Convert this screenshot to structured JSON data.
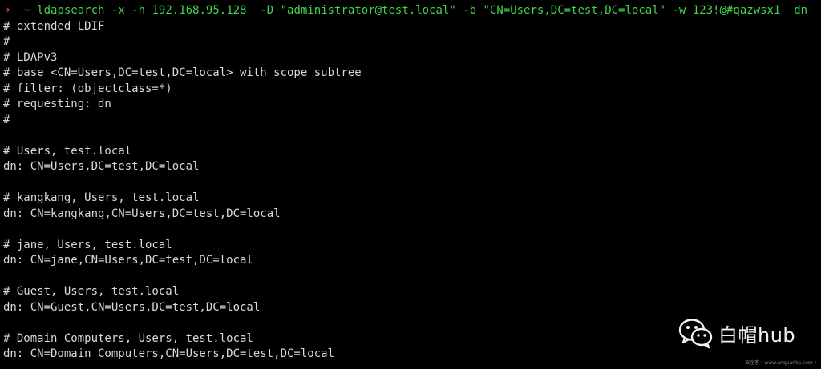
{
  "terminal": {
    "prompt": {
      "arrow": "➜",
      "cwd": "~",
      "command": "ldapsearch",
      "args": "-x -h 192.168.95.128  -D \"administrator@test.local\" -b \"CN=Users,DC=test,DC=local\" -w 123!@#qazwsx1  dn"
    },
    "output_lines": [
      "# extended LDIF",
      "#",
      "# LDAPv3",
      "# base <CN=Users,DC=test,DC=local> with scope subtree",
      "# filter: (objectclass=*)",
      "# requesting: dn",
      "#",
      "",
      "# Users, test.local",
      "dn: CN=Users,DC=test,DC=local",
      "",
      "# kangkang, Users, test.local",
      "dn: CN=kangkang,CN=Users,DC=test,DC=local",
      "",
      "# jane, Users, test.local",
      "dn: CN=jane,CN=Users,DC=test,DC=local",
      "",
      "# Guest, Users, test.local",
      "dn: CN=Guest,CN=Users,DC=test,DC=local",
      "",
      "# Domain Computers, Users, test.local",
      "dn: CN=Domain Computers,CN=Users,DC=test,DC=local"
    ]
  },
  "watermark": {
    "icon": "wechat-icon",
    "text": "白帽hub"
  },
  "site_mark": {
    "text": "安全客 ( www.anquanke.com )"
  },
  "colors": {
    "background": "#000000",
    "text": "#d9d9d9",
    "prompt_arrow": "#e8363a",
    "prompt_cwd": "#37c2d2",
    "command": "#42d34a"
  }
}
